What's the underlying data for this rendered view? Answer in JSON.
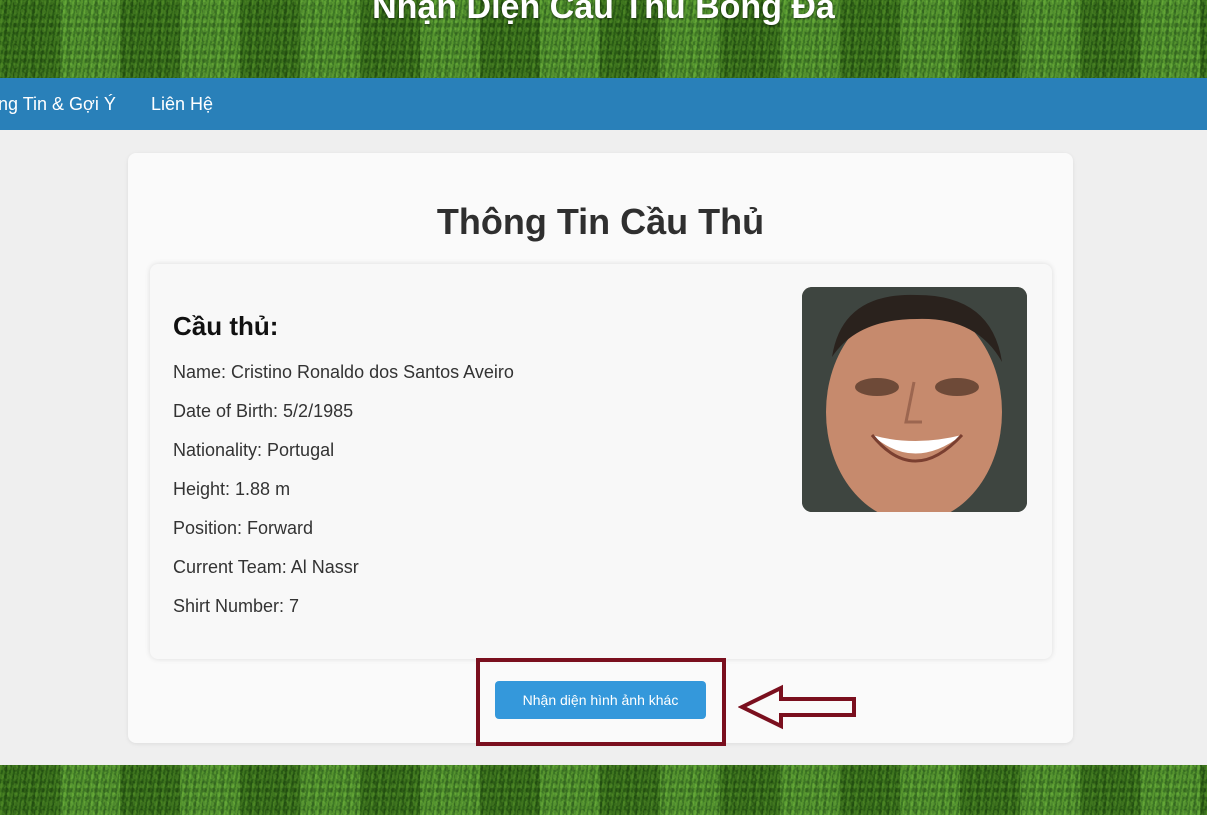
{
  "header": {
    "title": "Nhận Diện Cầu Thủ Bóng Đá"
  },
  "nav": {
    "items": [
      {
        "label": "ng Tin & Gợi Ý"
      },
      {
        "label": "Liên Hệ"
      }
    ]
  },
  "card": {
    "title": "Thông Tin Cầu Thủ",
    "player_heading": "Cầu thủ:",
    "fields": [
      "Name: Cristino Ronaldo dos Santos Aveiro",
      "Date of Birth: 5/2/1985",
      "Nationality: Portugal",
      "Height: 1.88 m",
      "Position: Forward",
      "Current Team: Al Nassr",
      "Shirt Number: 7"
    ],
    "button_label": "Nhận diện hình ảnh khác"
  },
  "colors": {
    "nav": "#2980b9",
    "button": "#3498db",
    "annotation": "#7a0f1e"
  }
}
